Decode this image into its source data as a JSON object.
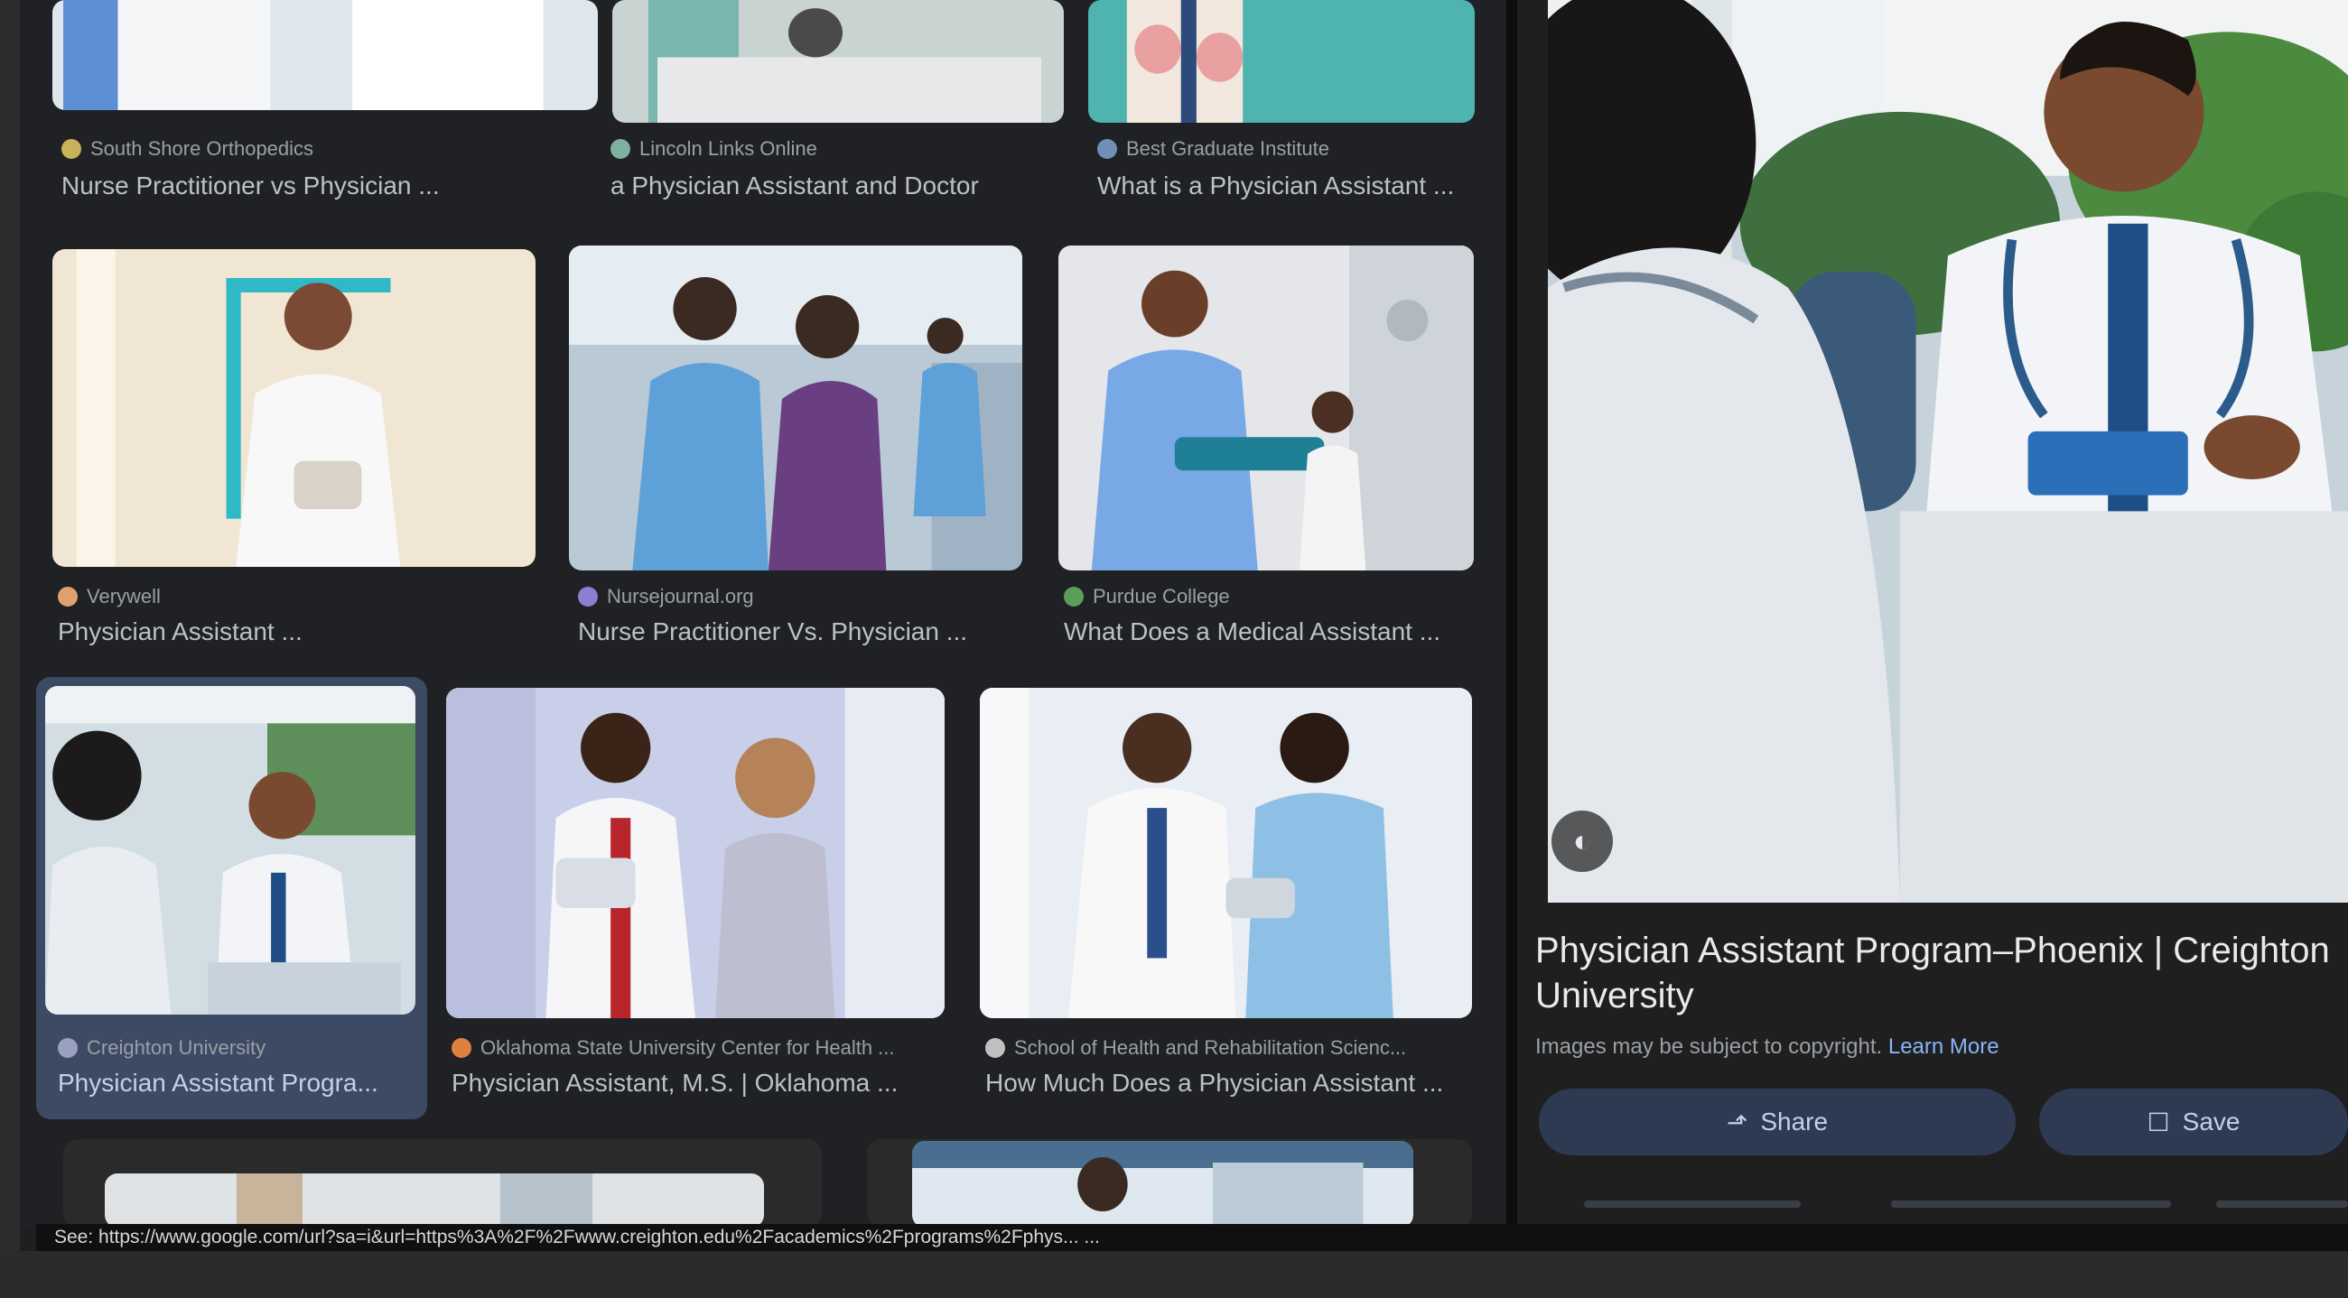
{
  "results": [
    {
      "source": "South Shore Orthopedics",
      "title": "Nurse Practitioner vs Physician ...",
      "favicon_color": "#c9b25a"
    },
    {
      "source": "Lincoln Links Online",
      "title": "a Physician Assistant and Doctor",
      "favicon_color": "#7fb0a0"
    },
    {
      "source": "Best Graduate Institute",
      "title": "What is a Physician Assistant ...",
      "favicon_color": "#6f8fb8"
    },
    {
      "source": "Verywell",
      "title": "Physician Assistant ...",
      "favicon_color": "#e0a070"
    },
    {
      "source": "Nursejournal.org",
      "title": "Nurse Practitioner Vs. Physician ...",
      "favicon_color": "#8a7fd0"
    },
    {
      "source": "Purdue College",
      "title": "What Does a Medical Assistant ...",
      "favicon_color": "#5a9e5a"
    },
    {
      "source": "Creighton University",
      "title": "Physician Assistant Progra...",
      "favicon_color": "#9aa0c0",
      "selected": true
    },
    {
      "source": "Oklahoma State University Center for Health ...",
      "title": "Physician Assistant, M.S. | Oklahoma ...",
      "favicon_color": "#e08040"
    },
    {
      "source": "School of Health and Rehabilitation Scienc...",
      "title": "How Much Does a Physician Assistant ...",
      "favicon_color": "#c0c0c0"
    }
  ],
  "preview": {
    "title": "Physician Assistant Program–Phoenix | Creighton University",
    "copyright_text": "Images may be subject to copyright.",
    "learn_more": "Learn More",
    "share_label": "Share",
    "save_label": "Save",
    "share_icon": "share-icon",
    "save_icon": "bookmark-icon"
  },
  "status_url": "See: https://www.google.com/url?sa=i&url=https%3A%2F%2Fwww.creighton.edu%2Facademics%2Fprograms%2Fphys... ..."
}
